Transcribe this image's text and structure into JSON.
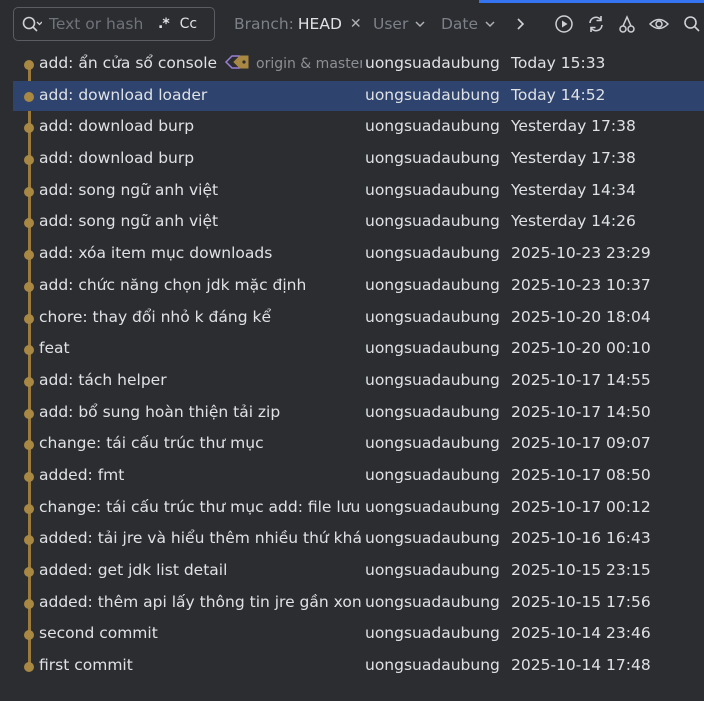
{
  "toolbar": {
    "search": {
      "placeholder": "Text or hash",
      "regex_label": ".*",
      "case_label": "Cc"
    },
    "branch_filter": {
      "label": "Branch:",
      "value": "HEAD"
    },
    "user_filter": {
      "label": "User"
    },
    "date_filter": {
      "label": "Date"
    }
  },
  "commits": [
    {
      "message": "add: ẩn cửa sổ console",
      "refs": "origin & master",
      "author": "uongsuadaubung",
      "date": "Today 15:33"
    },
    {
      "message": "add: download loader",
      "author": "uongsuadaubung",
      "date": "Today 14:52"
    },
    {
      "message": "add: download burp",
      "author": "uongsuadaubung",
      "date": "Yesterday 17:38"
    },
    {
      "message": "add: download burp",
      "author": "uongsuadaubung",
      "date": "Yesterday 17:38"
    },
    {
      "message": "add: song ngữ anh việt",
      "author": "uongsuadaubung",
      "date": "Yesterday 14:34"
    },
    {
      "message": "add: song ngữ anh việt",
      "author": "uongsuadaubung",
      "date": "Yesterday 14:26"
    },
    {
      "message": "add: xóa item mục downloads",
      "author": "uongsuadaubung",
      "date": "2025-10-23 23:29"
    },
    {
      "message": "add: chức năng chọn jdk mặc định",
      "author": "uongsuadaubung",
      "date": "2025-10-23 10:37"
    },
    {
      "message": "chore: thay đổi nhỏ k đáng kể",
      "author": "uongsuadaubung",
      "date": "2025-10-20 18:04"
    },
    {
      "message": "feat",
      "author": "uongsuadaubung",
      "date": "2025-10-20 00:10"
    },
    {
      "message": "add: tách helper",
      "author": "uongsuadaubung",
      "date": "2025-10-17 14:55"
    },
    {
      "message": "add: bổ sung hoàn thiện tải zip",
      "author": "uongsuadaubung",
      "date": "2025-10-17 14:50"
    },
    {
      "message": "change: tái cấu trúc thư mục",
      "author": "uongsuadaubung",
      "date": "2025-10-17 09:07"
    },
    {
      "message": "added: fmt",
      "author": "uongsuadaubung",
      "date": "2025-10-17 08:50"
    },
    {
      "message": "change: tái cấu trúc thư mục add: file lưu cá",
      "author": "uongsuadaubung",
      "date": "2025-10-17 00:12"
    },
    {
      "message": "added: tải jre và hiểu thêm nhiều thứ khác h",
      "author": "uongsuadaubung",
      "date": "2025-10-16 16:43"
    },
    {
      "message": "added: get jdk list detail",
      "author": "uongsuadaubung",
      "date": "2025-10-15 23:15"
    },
    {
      "message": "added: thêm api lấy thông tin jre gần xong",
      "author": "uongsuadaubung",
      "date": "2025-10-15 17:56"
    },
    {
      "message": "second commit",
      "author": "uongsuadaubung",
      "date": "2025-10-14 23:46"
    },
    {
      "message": "first commit",
      "author": "uongsuadaubung",
      "date": "2025-10-14 17:48"
    }
  ],
  "selected_index": 1,
  "colors": {
    "accent": "#3574f0",
    "selection": "#2e436e",
    "graph": "#a88842",
    "tag": "#a88842",
    "tag_remote": "#9b7fd6"
  }
}
